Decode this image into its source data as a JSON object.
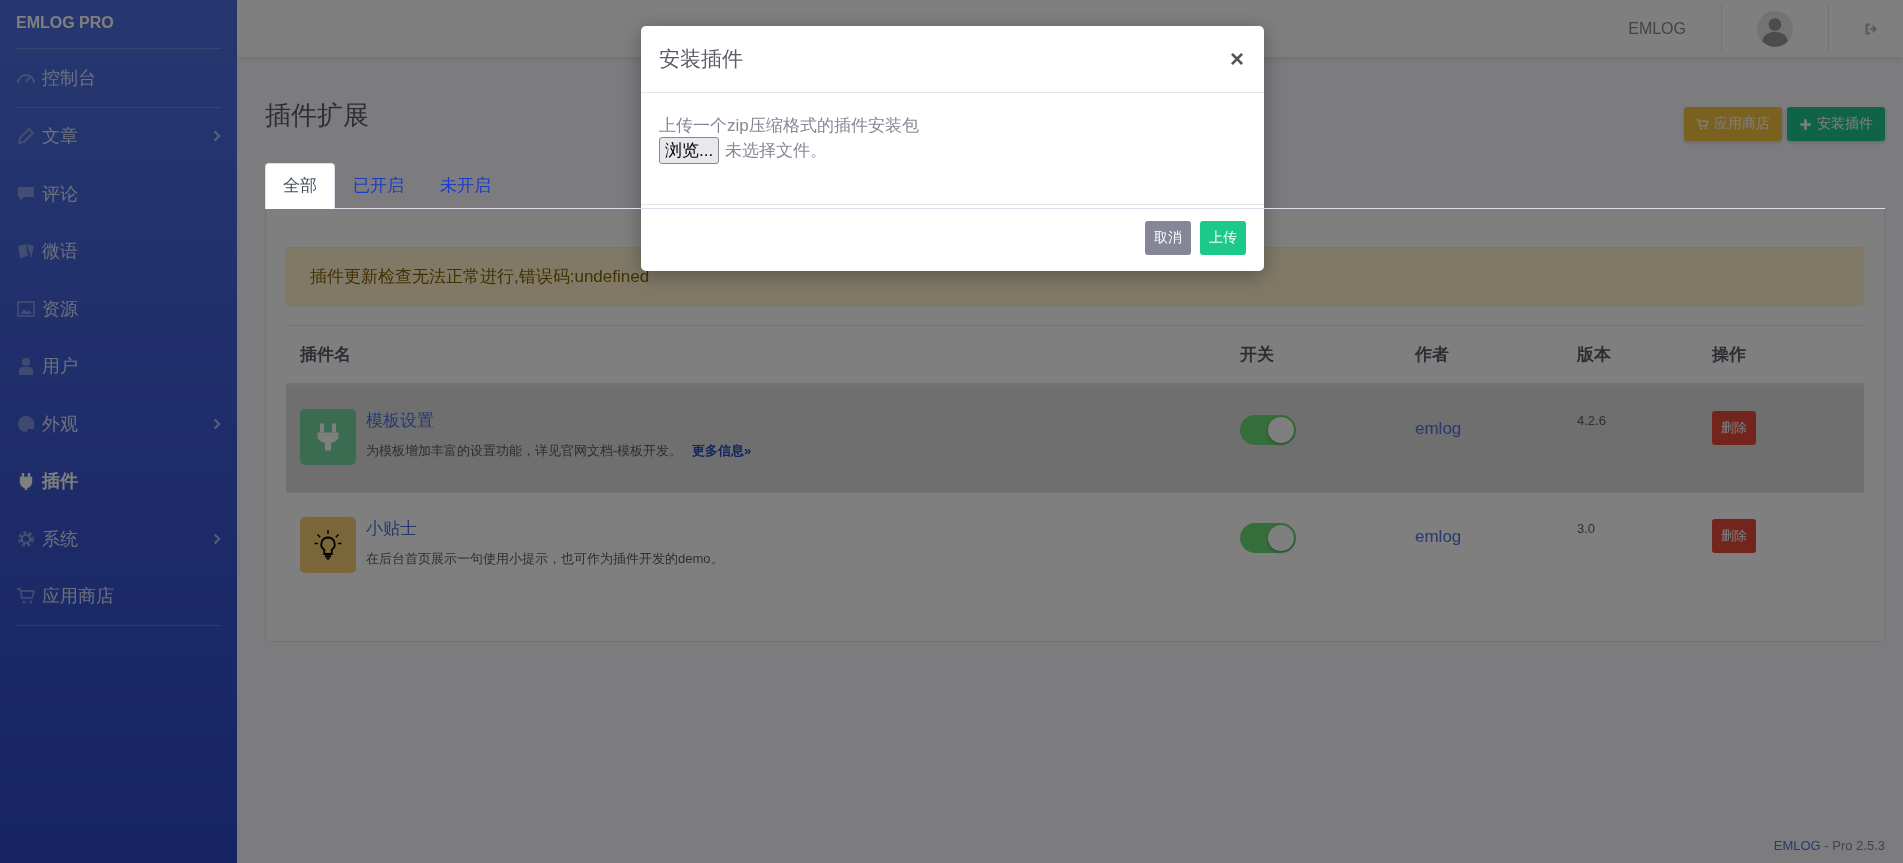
{
  "sidebar": {
    "brand": "EMLOG PRO",
    "sections": [
      {
        "items": [
          {
            "label": "控制台",
            "selected": false,
            "expandable": false
          }
        ]
      },
      {
        "items": [
          {
            "label": "文章",
            "selected": false,
            "expandable": true
          },
          {
            "label": "评论",
            "selected": false,
            "expandable": false
          },
          {
            "label": "微语",
            "selected": false,
            "expandable": false
          },
          {
            "label": "资源",
            "selected": false,
            "expandable": false
          },
          {
            "label": "用户",
            "selected": false,
            "expandable": false
          },
          {
            "label": "外观",
            "selected": false,
            "expandable": true
          },
          {
            "label": "插件",
            "selected": true,
            "expandable": false
          },
          {
            "label": "系统",
            "selected": false,
            "expandable": true
          },
          {
            "label": "应用商店",
            "selected": false,
            "expandable": false
          }
        ]
      }
    ]
  },
  "topbar": {
    "site": "EMLOG"
  },
  "page": {
    "title": "插件扩展",
    "buttons": [
      {
        "kind": "store",
        "label": "应用商店"
      },
      {
        "kind": "install",
        "label": "安装插件"
      }
    ]
  },
  "tabs": [
    {
      "label": "全部",
      "selected": true
    },
    {
      "label": "已开启",
      "selected": false
    },
    {
      "label": "未开启",
      "selected": false
    }
  ],
  "alert": "插件更新检查无法正常进行,错误码:undefined",
  "table": {
    "columns": [
      "插件名",
      "开关",
      "作者",
      "版本",
      "操作"
    ],
    "rows": [
      {
        "kind": "plug",
        "name": "模板设置",
        "description": "为模板增加丰富的设置功能，详见官网文档-模板开发。",
        "link": "更多信息»",
        "enabled": true,
        "author": "emlog",
        "version": "4.2.6",
        "action": "删除",
        "highlighted": true
      },
      {
        "kind": "bulb",
        "name": "小贴士",
        "description": "在后台首页展示一句使用小提示，也可作为插件开发的demo。",
        "enabled": true,
        "author": "emlog",
        "version": "3.0",
        "action": "删除",
        "highlighted": false
      }
    ]
  },
  "footer": {
    "brand": "EMLOG",
    "version": " - Pro 2.5.3"
  },
  "modal": {
    "title": "安装插件",
    "close": "×",
    "instruction": "上传一个zip压缩格式的插件安装包",
    "browse": "浏览...",
    "file_status": "未选择文件。",
    "buttons": [
      {
        "kind": "cancel",
        "label": "取消"
      },
      {
        "kind": "upload",
        "label": "上传"
      }
    ]
  }
}
